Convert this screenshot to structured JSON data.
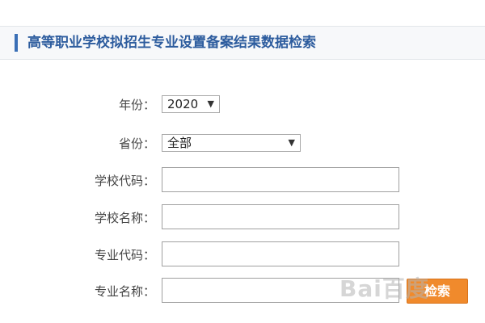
{
  "header": {
    "title": "高等职业学校拟招生专业设置备案结果数据检索"
  },
  "form": {
    "year": {
      "label": "年份：",
      "value": "2020"
    },
    "province": {
      "label": "省份：",
      "value": "全部"
    },
    "school_code": {
      "label": "学校代码：",
      "value": ""
    },
    "school_name": {
      "label": "学校名称：",
      "value": ""
    },
    "major_code": {
      "label": "专业代码：",
      "value": ""
    },
    "major_name": {
      "label": "专业名称：",
      "value": ""
    },
    "search_label": "检索"
  },
  "watermark": "Bai百度",
  "colors": {
    "accent": "#3a6fb6",
    "title": "#2d5c9e",
    "button": "#f08a2c"
  },
  "icons": {
    "dropdown": "chevron-down-icon"
  }
}
